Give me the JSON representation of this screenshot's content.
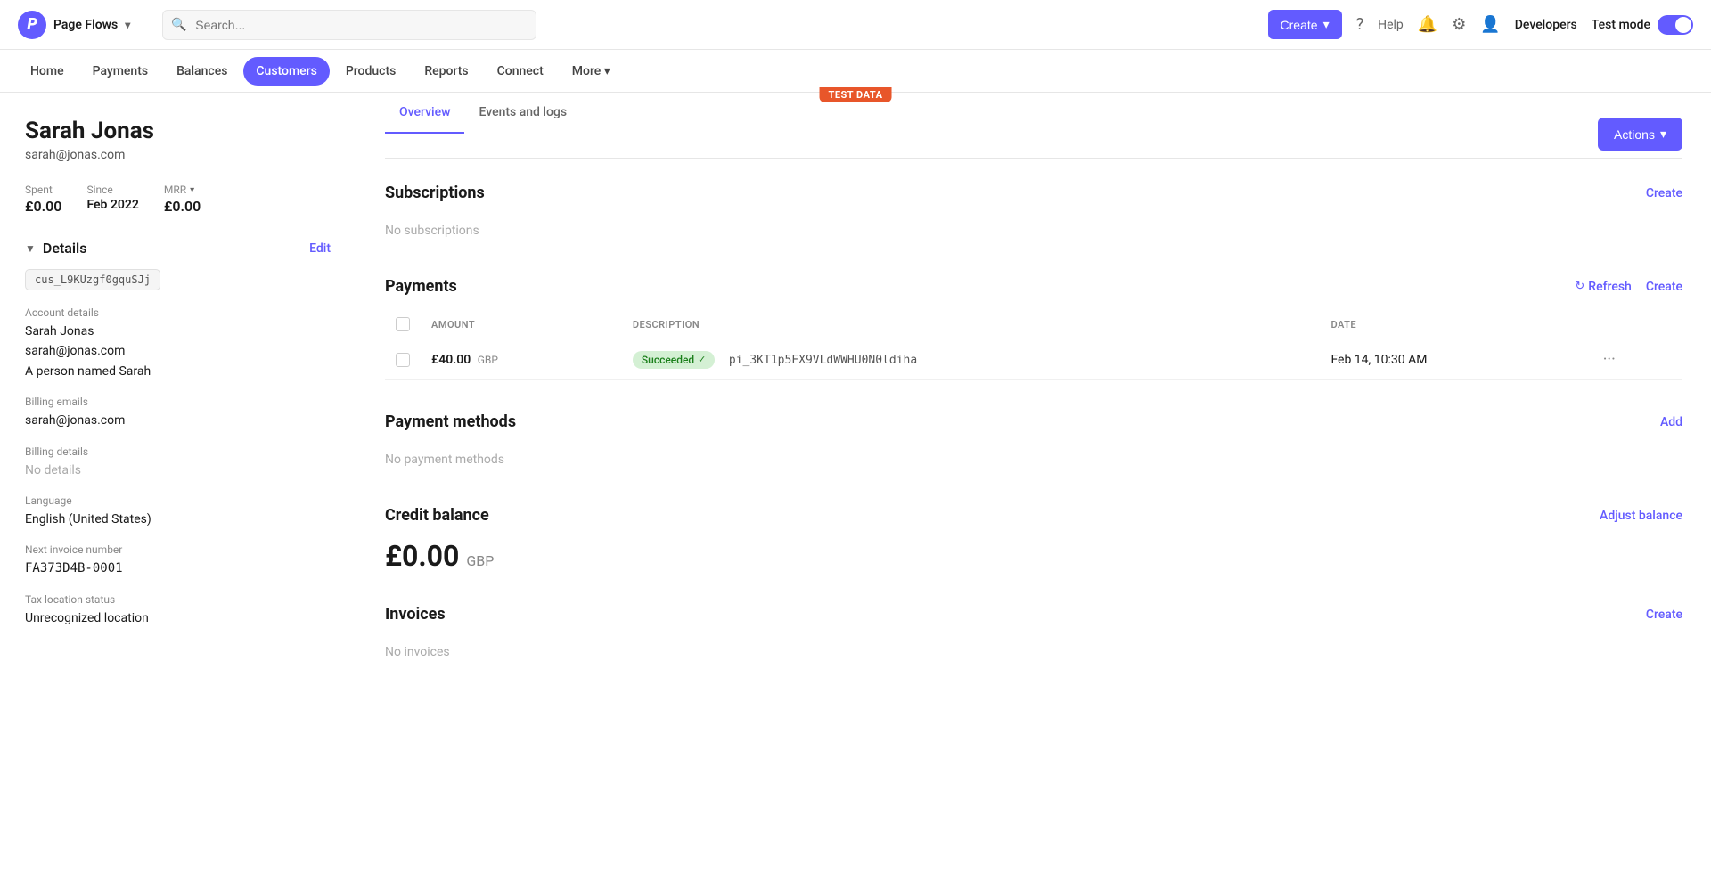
{
  "app": {
    "logo_text": "P",
    "brand_name": "Page Flows",
    "chevron": "▾"
  },
  "topbar": {
    "search_placeholder": "Search...",
    "create_label": "Create",
    "chevron": "▾",
    "help_label": "Help",
    "developers_label": "Developers",
    "test_mode_label": "Test mode"
  },
  "nav": {
    "items": [
      {
        "label": "Home",
        "active": false
      },
      {
        "label": "Payments",
        "active": false
      },
      {
        "label": "Balances",
        "active": false
      },
      {
        "label": "Customers",
        "active": true
      },
      {
        "label": "Products",
        "active": false
      },
      {
        "label": "Reports",
        "active": false
      },
      {
        "label": "Connect",
        "active": false
      },
      {
        "label": "More",
        "active": false
      }
    ],
    "test_data_badge": "TEST DATA"
  },
  "customer": {
    "name": "Sarah Jonas",
    "email": "sarah@jonas.com",
    "stats": {
      "spent_label": "Spent",
      "spent_value": "£0.00",
      "since_label": "Since",
      "since_value": "Feb 2022",
      "mrr_label": "MRR",
      "mrr_value": "£0.00"
    },
    "details_title": "Details",
    "edit_label": "Edit",
    "cus_id": "cus_L9KUzgf0gquSJj",
    "account_details_label": "Account details",
    "account_details_values": [
      "Sarah Jonas",
      "sarah@jonas.com",
      "A person named Sarah"
    ],
    "billing_emails_label": "Billing emails",
    "billing_emails_value": "sarah@jonas.com",
    "billing_details_label": "Billing details",
    "billing_details_value": "No details",
    "language_label": "Language",
    "language_value": "English (United States)",
    "next_invoice_label": "Next invoice number",
    "next_invoice_value": "FA373D4B-0001",
    "tax_location_label": "Tax location status",
    "tax_location_value": "Unrecognized location"
  },
  "tabs": [
    {
      "label": "Overview",
      "active": true
    },
    {
      "label": "Events and logs",
      "active": false
    }
  ],
  "actions_label": "Actions",
  "sections": {
    "subscriptions": {
      "title": "Subscriptions",
      "create_label": "Create",
      "empty_text": "No subscriptions"
    },
    "payments": {
      "title": "Payments",
      "refresh_label": "Refresh",
      "create_label": "Create",
      "columns": [
        "AMOUNT",
        "DESCRIPTION",
        "DATE"
      ],
      "rows": [
        {
          "amount": "£40.00",
          "currency": "GBP",
          "status": "Succeeded",
          "description": "pi_3KT1p5FX9VLdWWHU0N0ldiha",
          "date": "Feb 14, 10:30 AM"
        }
      ]
    },
    "payment_methods": {
      "title": "Payment methods",
      "add_label": "Add",
      "empty_text": "No payment methods"
    },
    "credit_balance": {
      "title": "Credit balance",
      "adjust_label": "Adjust balance",
      "amount": "£0.00",
      "currency": "GBP"
    },
    "invoices": {
      "title": "Invoices",
      "create_label": "Create",
      "empty_text": "No invoices"
    }
  }
}
